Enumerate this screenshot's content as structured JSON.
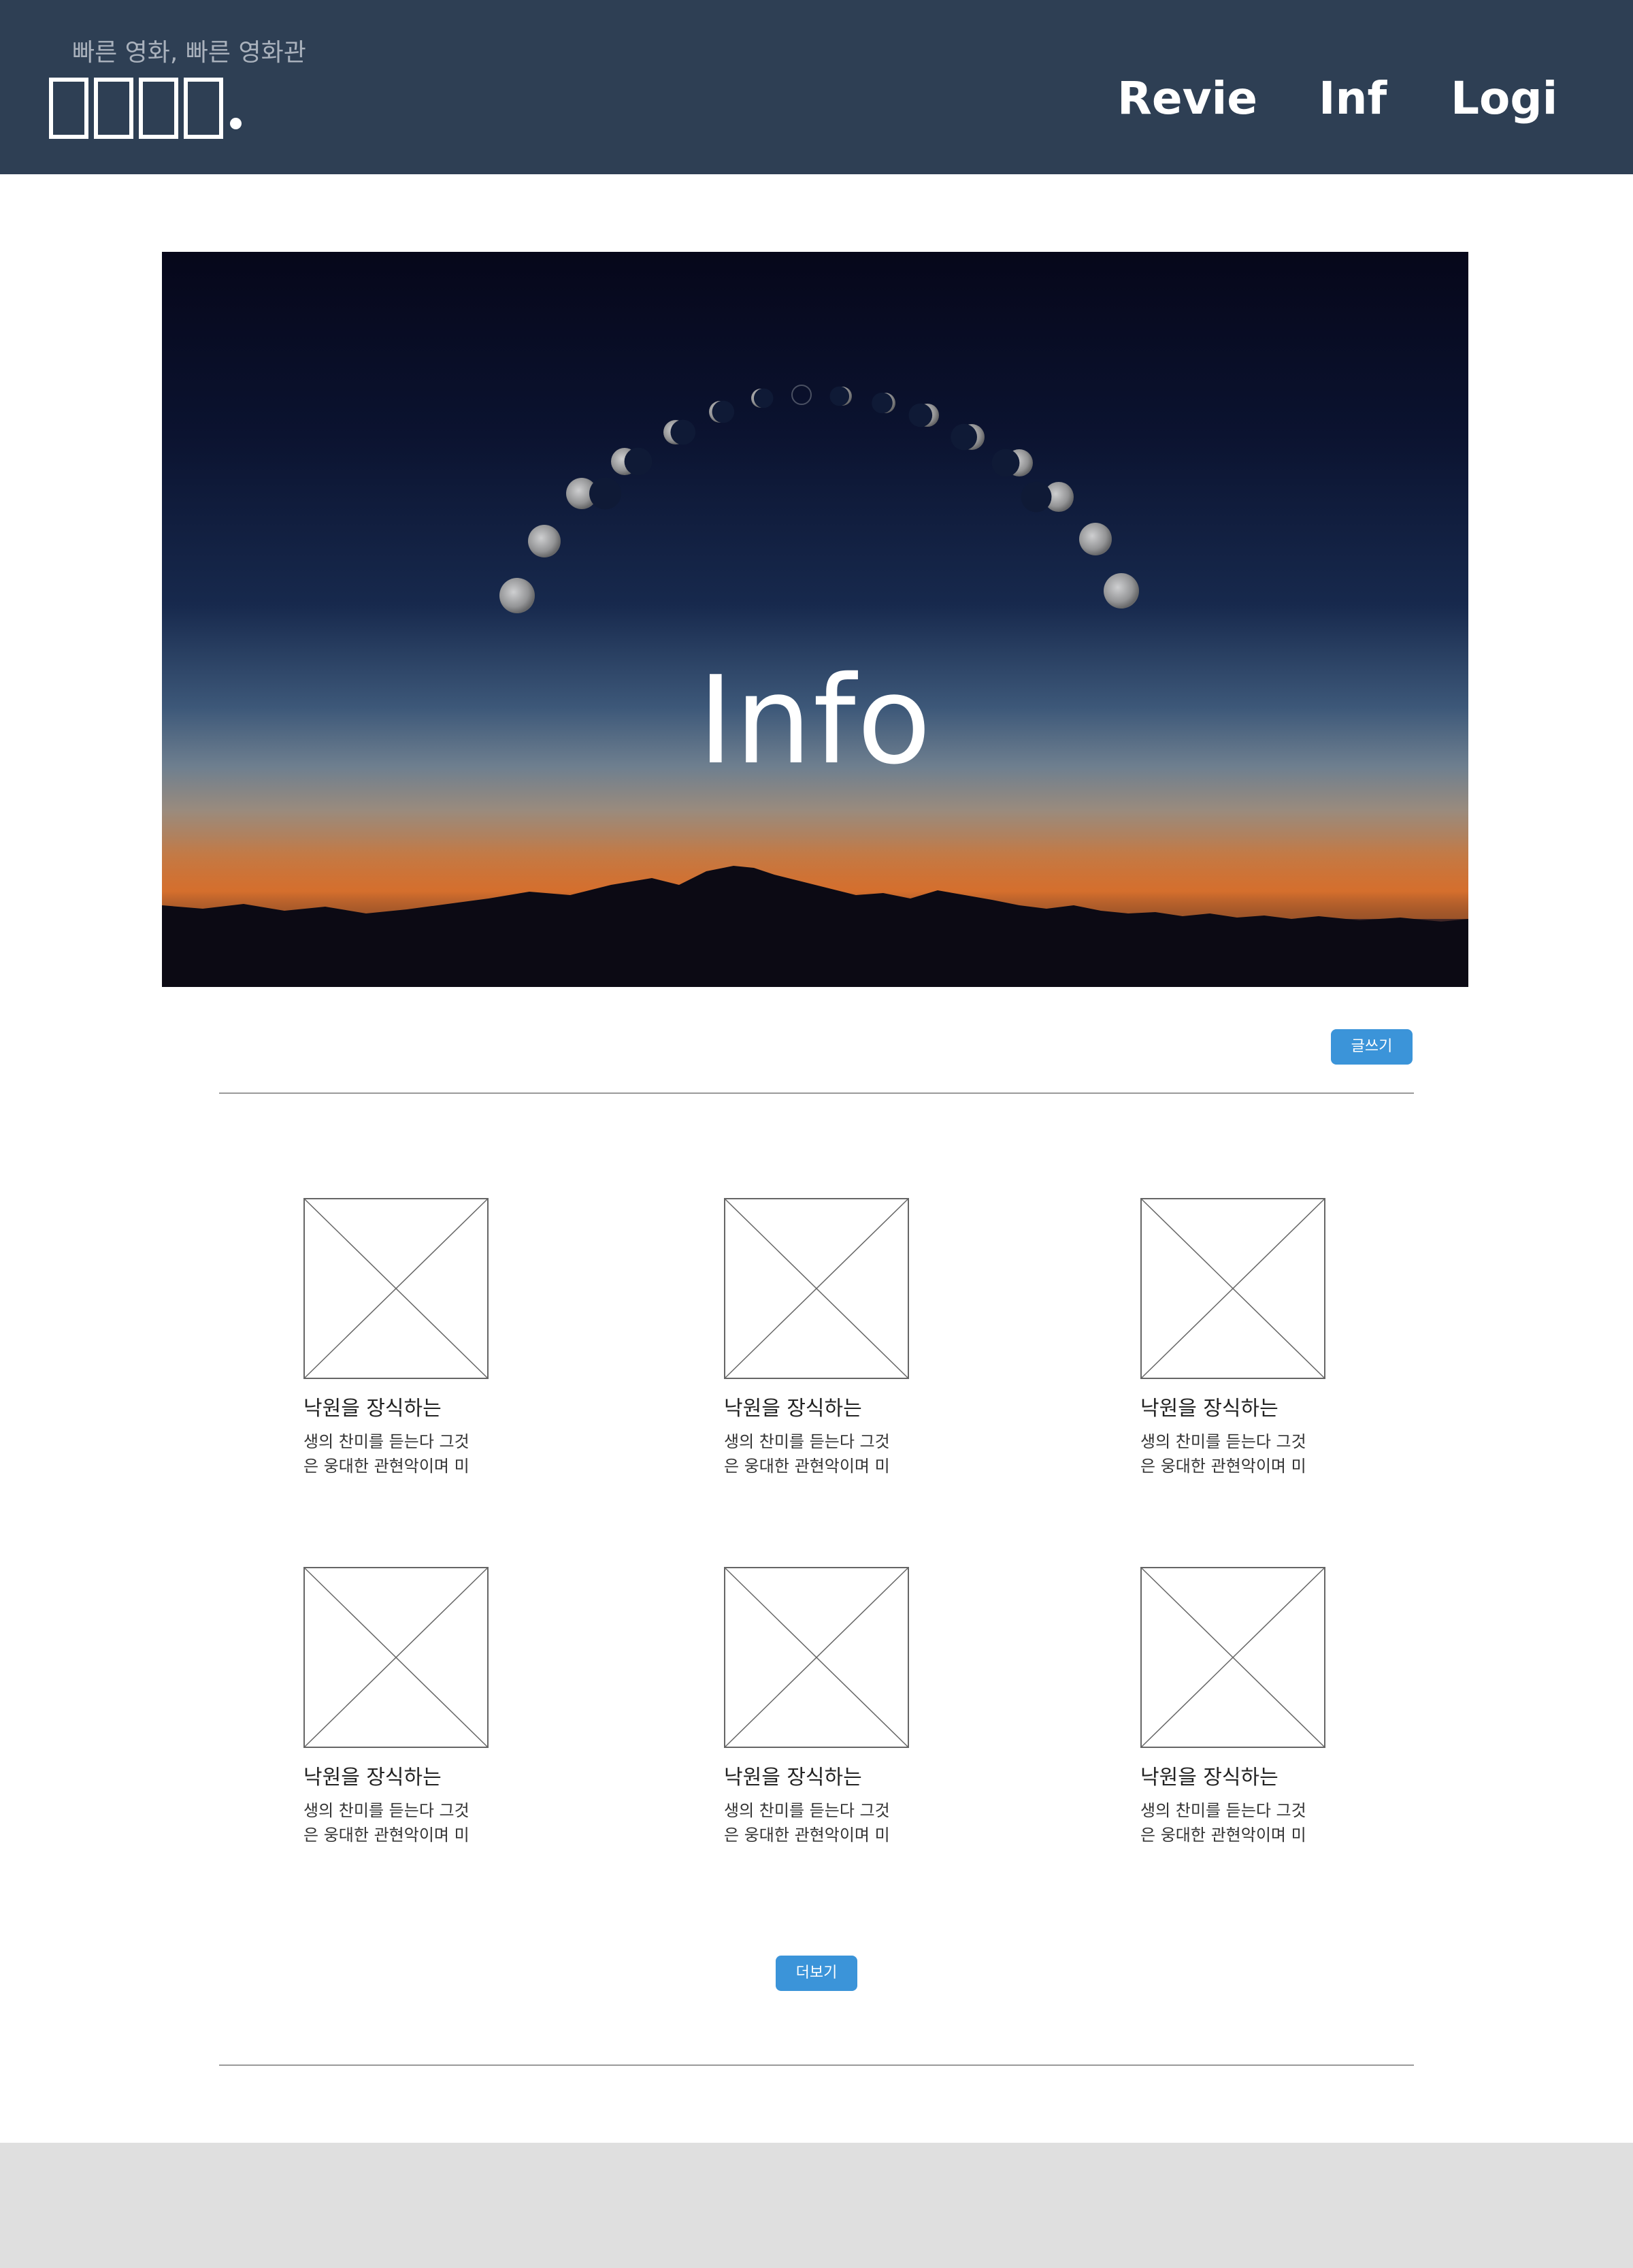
{
  "header": {
    "tagline": "빠른 영화, 빠른 영화관",
    "logo_glyph_count": 4,
    "nav": [
      {
        "label": "Revie"
      },
      {
        "label": "Inf"
      },
      {
        "label": "Logi"
      }
    ],
    "background_color": "#2e3f54"
  },
  "hero": {
    "title": "Info",
    "image_subject": "moon phases arc over mountain sunset"
  },
  "actions": {
    "write_label": "글쓰기",
    "more_label": "더보기",
    "accent_color": "#3b94d9"
  },
  "cards": [
    {
      "image": "placeholder-image",
      "title": "낙원을 장식하는",
      "desc_line1": "생의 찬미를 듣는다 그것",
      "desc_line2": "은 웅대한 관현악이며 미"
    },
    {
      "image": "placeholder-image",
      "title": "낙원을 장식하는",
      "desc_line1": "생의 찬미를 듣는다 그것",
      "desc_line2": "은 웅대한 관현악이며 미"
    },
    {
      "image": "placeholder-image",
      "title": "낙원을 장식하는",
      "desc_line1": "생의 찬미를 듣는다 그것",
      "desc_line2": "은 웅대한 관현악이며 미"
    },
    {
      "image": "placeholder-image",
      "title": "낙원을 장식하는",
      "desc_line1": "생의 찬미를 듣는다 그것",
      "desc_line2": "은 웅대한 관현악이며 미"
    },
    {
      "image": "placeholder-image",
      "title": "낙원을 장식하는",
      "desc_line1": "생의 찬미를 듣는다 그것",
      "desc_line2": "은 웅대한 관현악이며 미"
    },
    {
      "image": "placeholder-image",
      "title": "낙원을 장식하는",
      "desc_line1": "생의 찬미를 듣는다 그것",
      "desc_line2": "은 웅대한 관현악이며 미"
    }
  ]
}
